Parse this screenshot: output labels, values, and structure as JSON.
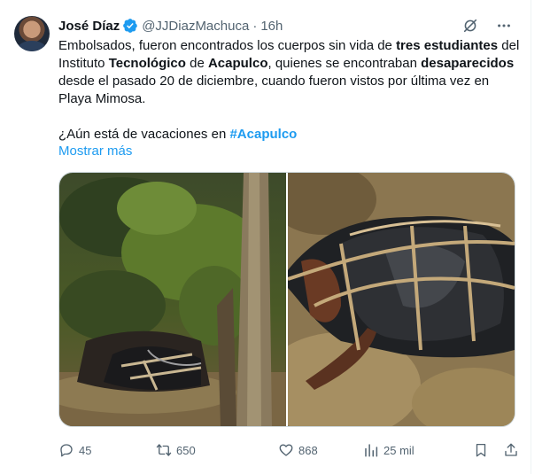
{
  "tweet": {
    "author_name": "José Díaz",
    "handle": "@JJDiazMachuca",
    "separator": "·",
    "time": "16h",
    "text_segments": [
      {
        "t": "Embolsados, fueron encontrados los cuerpos sin vida de ",
        "b": false
      },
      {
        "t": "tres estudiantes",
        "b": true
      },
      {
        "t": " del Instituto ",
        "b": false
      },
      {
        "t": "Tecnológico",
        "b": true
      },
      {
        "t": " de ",
        "b": false
      },
      {
        "t": "Acapulco",
        "b": true
      },
      {
        "t": ", quienes se encontraban ",
        "b": false
      },
      {
        "t": "desaparecidos",
        "b": true
      },
      {
        "t": " desde el pasado 20 de diciembre, cuando fueron vistos por última vez en Playa Mimosa.\n\n¿Aún está de vacaciones en ",
        "b": false
      }
    ],
    "hashtag": "#Acapulco",
    "show_more": "Mostrar más",
    "icons": {
      "verified": "verified-badge-icon",
      "grok": "grok-icon",
      "more": "more-icon"
    },
    "colors": {
      "accent": "#1d9bf0",
      "muted": "#536471",
      "text": "#0f1419"
    }
  },
  "media": {
    "images": [
      {
        "name": "photo-left",
        "description_icon": "image"
      },
      {
        "name": "photo-right",
        "description_icon": "image"
      }
    ]
  },
  "actions": {
    "reply_count": "45",
    "retweet_count": "650",
    "like_count": "868",
    "views_count": "25 mil",
    "icons": [
      "reply-icon",
      "retweet-icon",
      "like-icon",
      "views-icon",
      "bookmark-icon",
      "share-icon"
    ]
  }
}
